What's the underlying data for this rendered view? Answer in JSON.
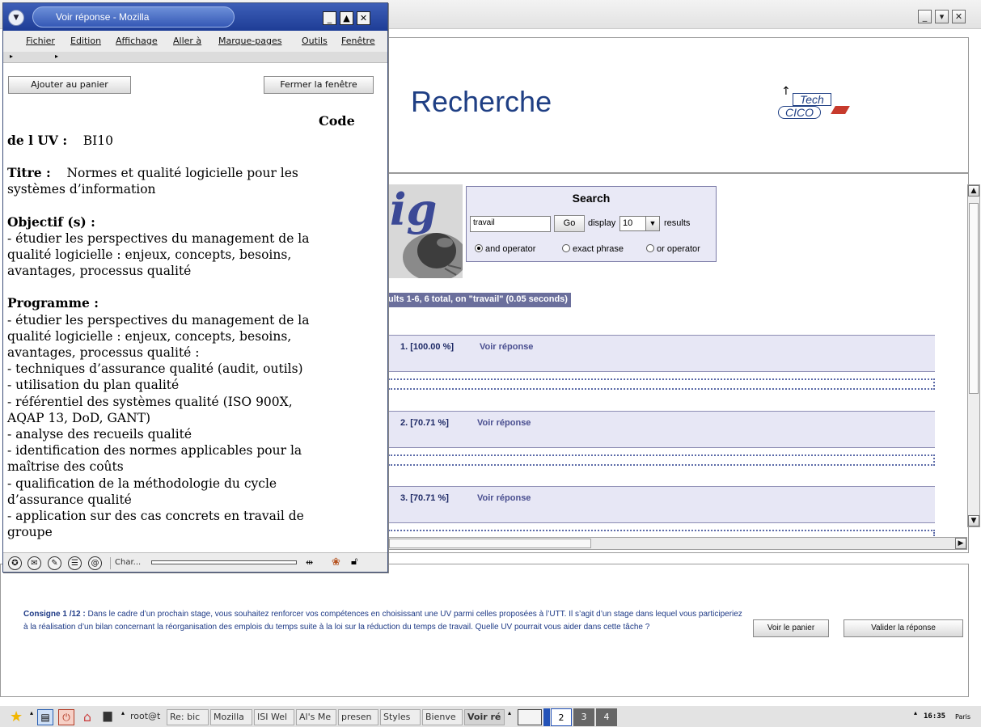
{
  "popup": {
    "title": "Voir réponse - Mozilla",
    "menu": [
      "Fichier",
      "Edition",
      "Affichage",
      "Aller à",
      "Marque-pages",
      "Outils",
      "Fenêtre"
    ],
    "add_to_cart": "Ajouter au panier",
    "close_window": "Fermer la fenêtre",
    "code_label_a": "Code",
    "code_label_b": "de l UV :",
    "code_value": "BI10",
    "title_label": "Titre :",
    "title_value": "Normes et qualité logicielle pour les",
    "title_value2": "systèmes d’information",
    "objectif_label": "Objectif (s) :",
    "objectif_lines": [
      "- étudier les perspectives du management de la",
      "qualité logicielle : enjeux, concepts, besoins,",
      "avantages, processus qualité"
    ],
    "programme_label": "Programme :",
    "programme_lines": [
      "- étudier les perspectives du management de la",
      "qualité logicielle : enjeux, concepts, besoins,",
      "avantages, processus qualité :",
      "- techniques d’assurance qualité (audit, outils)",
      "- utilisation du plan qualité",
      "- référentiel des systèmes qualité (ISO 900X,",
      "AQAP 13, DoD, GANT)",
      "- analyse des recueils qualité",
      "- identification des normes applicables pour la",
      "maîtrise des coûts",
      "- qualification de la méthodologie du cycle",
      "d’assurance qualité",
      "- application sur des cas concrets en travail de",
      "groupe"
    ],
    "status_text": "Char..."
  },
  "main": {
    "heading": "Recherche",
    "logo": {
      "top": "Tech",
      "bottom": "CICO"
    },
    "search": {
      "title": "Search",
      "query": "travail",
      "go": "Go",
      "display_label": "display",
      "display_value": "10",
      "results_label": "results",
      "options": [
        "and operator",
        "exact phrase",
        "or operator"
      ],
      "selected_option": "and operator"
    },
    "summary": "ults 1-6, 6 total, on \"travail\" (0.05 seconds)",
    "results": [
      {
        "num": "1. [100.00 %]",
        "link": "Voir réponse"
      },
      {
        "num": "2. [70.71 %]",
        "link": "Voir réponse"
      },
      {
        "num": "3. [70.71 %]",
        "link": "Voir réponse"
      }
    ],
    "consigne_label": "Consigne 1",
    "consigne_count": "/12 :",
    "consigne_text": "Dans le cadre d’un prochain stage, vous souhaitez renforcer vos compétences en choisissant une UV parmi celles proposées à l’UTT. Il s’agit d’un stage dans lequel vous participeriez à la réalisation d’un bilan concernant la réorganisation des emplois du temps suite à la loi sur la réduction du temps de travail. Quelle UV pourrait vous aider dans cette tâche ?",
    "view_cart": "Voir le panier",
    "validate": "Valider la réponse"
  },
  "taskbar": {
    "items": [
      "root@t",
      "Re: bic",
      "Mozilla",
      "ISI Wel",
      "Al's Me",
      "presen",
      "Styles",
      "Bienve",
      "Voir ré"
    ],
    "desktops": [
      "2",
      "3",
      "4"
    ],
    "clock": "16:35",
    "location": "Paris"
  },
  "colors": {
    "accent": "#1f3f84",
    "titlebar": "#2b4ea8",
    "result_bg": "#e7e7f5",
    "summary_bg": "#6b6f9c"
  }
}
